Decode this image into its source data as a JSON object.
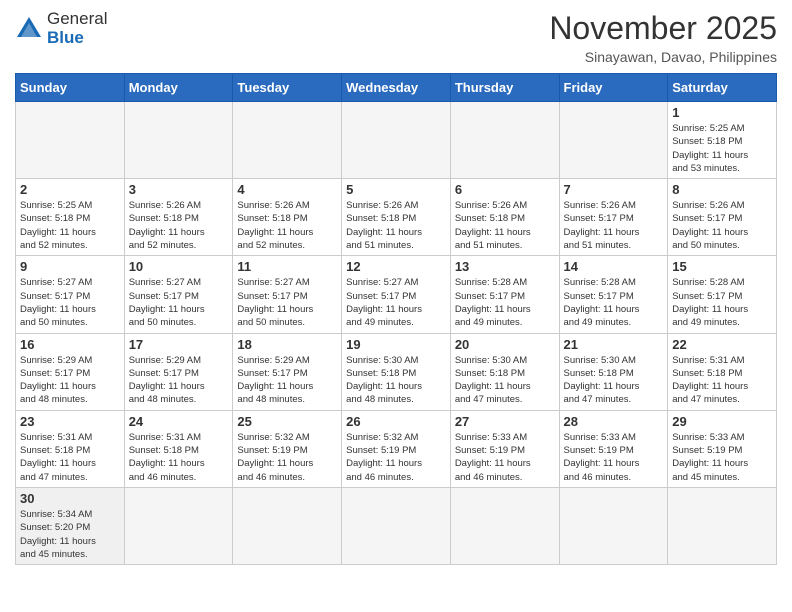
{
  "header": {
    "logo_general": "General",
    "logo_blue": "Blue",
    "month_title": "November 2025",
    "location": "Sinayawan, Davao, Philippines"
  },
  "weekdays": [
    "Sunday",
    "Monday",
    "Tuesday",
    "Wednesday",
    "Thursday",
    "Friday",
    "Saturday"
  ],
  "weeks": [
    [
      {
        "day": "",
        "info": ""
      },
      {
        "day": "",
        "info": ""
      },
      {
        "day": "",
        "info": ""
      },
      {
        "day": "",
        "info": ""
      },
      {
        "day": "",
        "info": ""
      },
      {
        "day": "",
        "info": ""
      },
      {
        "day": "1",
        "info": "Sunrise: 5:25 AM\nSunset: 5:18 PM\nDaylight: 11 hours\nand 53 minutes."
      }
    ],
    [
      {
        "day": "2",
        "info": "Sunrise: 5:25 AM\nSunset: 5:18 PM\nDaylight: 11 hours\nand 52 minutes."
      },
      {
        "day": "3",
        "info": "Sunrise: 5:26 AM\nSunset: 5:18 PM\nDaylight: 11 hours\nand 52 minutes."
      },
      {
        "day": "4",
        "info": "Sunrise: 5:26 AM\nSunset: 5:18 PM\nDaylight: 11 hours\nand 52 minutes."
      },
      {
        "day": "5",
        "info": "Sunrise: 5:26 AM\nSunset: 5:18 PM\nDaylight: 11 hours\nand 51 minutes."
      },
      {
        "day": "6",
        "info": "Sunrise: 5:26 AM\nSunset: 5:18 PM\nDaylight: 11 hours\nand 51 minutes."
      },
      {
        "day": "7",
        "info": "Sunrise: 5:26 AM\nSunset: 5:17 PM\nDaylight: 11 hours\nand 51 minutes."
      },
      {
        "day": "8",
        "info": "Sunrise: 5:26 AM\nSunset: 5:17 PM\nDaylight: 11 hours\nand 50 minutes."
      }
    ],
    [
      {
        "day": "9",
        "info": "Sunrise: 5:27 AM\nSunset: 5:17 PM\nDaylight: 11 hours\nand 50 minutes."
      },
      {
        "day": "10",
        "info": "Sunrise: 5:27 AM\nSunset: 5:17 PM\nDaylight: 11 hours\nand 50 minutes."
      },
      {
        "day": "11",
        "info": "Sunrise: 5:27 AM\nSunset: 5:17 PM\nDaylight: 11 hours\nand 50 minutes."
      },
      {
        "day": "12",
        "info": "Sunrise: 5:27 AM\nSunset: 5:17 PM\nDaylight: 11 hours\nand 49 minutes."
      },
      {
        "day": "13",
        "info": "Sunrise: 5:28 AM\nSunset: 5:17 PM\nDaylight: 11 hours\nand 49 minutes."
      },
      {
        "day": "14",
        "info": "Sunrise: 5:28 AM\nSunset: 5:17 PM\nDaylight: 11 hours\nand 49 minutes."
      },
      {
        "day": "15",
        "info": "Sunrise: 5:28 AM\nSunset: 5:17 PM\nDaylight: 11 hours\nand 49 minutes."
      }
    ],
    [
      {
        "day": "16",
        "info": "Sunrise: 5:29 AM\nSunset: 5:17 PM\nDaylight: 11 hours\nand 48 minutes."
      },
      {
        "day": "17",
        "info": "Sunrise: 5:29 AM\nSunset: 5:17 PM\nDaylight: 11 hours\nand 48 minutes."
      },
      {
        "day": "18",
        "info": "Sunrise: 5:29 AM\nSunset: 5:17 PM\nDaylight: 11 hours\nand 48 minutes."
      },
      {
        "day": "19",
        "info": "Sunrise: 5:30 AM\nSunset: 5:18 PM\nDaylight: 11 hours\nand 48 minutes."
      },
      {
        "day": "20",
        "info": "Sunrise: 5:30 AM\nSunset: 5:18 PM\nDaylight: 11 hours\nand 47 minutes."
      },
      {
        "day": "21",
        "info": "Sunrise: 5:30 AM\nSunset: 5:18 PM\nDaylight: 11 hours\nand 47 minutes."
      },
      {
        "day": "22",
        "info": "Sunrise: 5:31 AM\nSunset: 5:18 PM\nDaylight: 11 hours\nand 47 minutes."
      }
    ],
    [
      {
        "day": "23",
        "info": "Sunrise: 5:31 AM\nSunset: 5:18 PM\nDaylight: 11 hours\nand 47 minutes."
      },
      {
        "day": "24",
        "info": "Sunrise: 5:31 AM\nSunset: 5:18 PM\nDaylight: 11 hours\nand 46 minutes."
      },
      {
        "day": "25",
        "info": "Sunrise: 5:32 AM\nSunset: 5:19 PM\nDaylight: 11 hours\nand 46 minutes."
      },
      {
        "day": "26",
        "info": "Sunrise: 5:32 AM\nSunset: 5:19 PM\nDaylight: 11 hours\nand 46 minutes."
      },
      {
        "day": "27",
        "info": "Sunrise: 5:33 AM\nSunset: 5:19 PM\nDaylight: 11 hours\nand 46 minutes."
      },
      {
        "day": "28",
        "info": "Sunrise: 5:33 AM\nSunset: 5:19 PM\nDaylight: 11 hours\nand 46 minutes."
      },
      {
        "day": "29",
        "info": "Sunrise: 5:33 AM\nSunset: 5:19 PM\nDaylight: 11 hours\nand 45 minutes."
      }
    ],
    [
      {
        "day": "30",
        "info": "Sunrise: 5:34 AM\nSunset: 5:20 PM\nDaylight: 11 hours\nand 45 minutes."
      },
      {
        "day": "",
        "info": ""
      },
      {
        "day": "",
        "info": ""
      },
      {
        "day": "",
        "info": ""
      },
      {
        "day": "",
        "info": ""
      },
      {
        "day": "",
        "info": ""
      },
      {
        "day": "",
        "info": ""
      }
    ]
  ]
}
